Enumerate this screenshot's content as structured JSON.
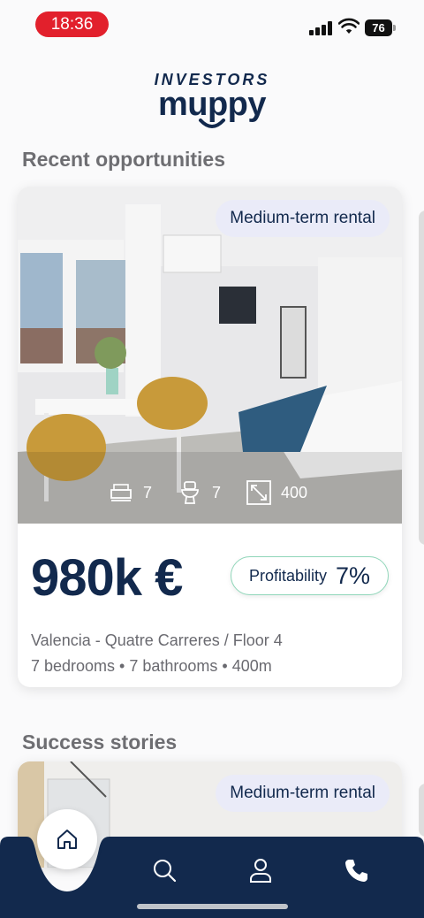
{
  "status_bar": {
    "time": "18:36",
    "battery": "76"
  },
  "logo": {
    "top": "INVESTORS",
    "main": "muppy"
  },
  "sections": {
    "recent": "Recent opportunities",
    "success": "Success stories"
  },
  "opportunity": {
    "tag": "Medium-term rental",
    "bedrooms": "7",
    "bathrooms": "7",
    "area": "400",
    "price": "980k €",
    "profitability_label": "Profitability",
    "profitability_value": "7%",
    "location": "Valencia - Quatre Carreres / Floor 4",
    "details": "7 bedrooms • 7 bathrooms • 400m"
  },
  "success_story": {
    "tag": "Medium-term rental"
  },
  "nav": {
    "items": [
      "home-icon",
      "search-icon",
      "user-icon",
      "phone-icon"
    ]
  },
  "colors": {
    "brand": "#12294d",
    "status_pill": "#e2202c",
    "profit_border": "#8fd6b9",
    "tag_bg": "#eaebf8"
  }
}
